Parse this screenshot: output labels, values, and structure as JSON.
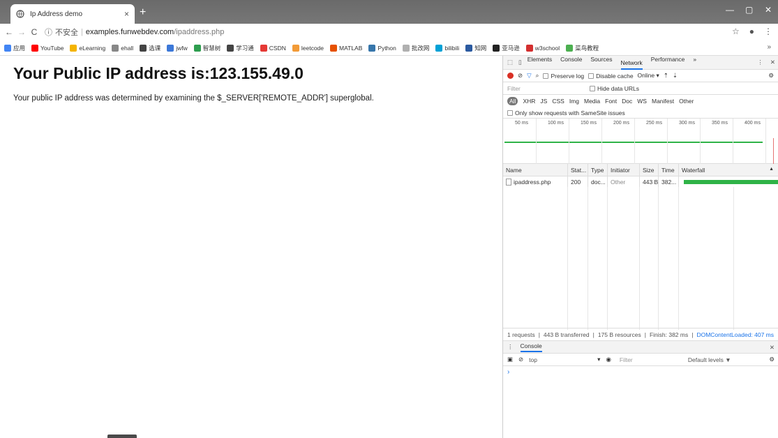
{
  "tab": {
    "title": "Ip Address demo",
    "close": "×",
    "new": "+"
  },
  "window": {
    "minimize": "—",
    "restore": "▢",
    "close": "✕"
  },
  "address": {
    "info_icon": "ⓘ",
    "insecure_label": "不安全",
    "separator": "|",
    "host": "examples.funwebdev.com",
    "path": "/ipaddress.php"
  },
  "bookmarks": [
    {
      "label": "应用",
      "color": "#4285f4"
    },
    {
      "label": "YouTube",
      "color": "#ff0000"
    },
    {
      "label": "eLearning",
      "color": "#f4b400"
    },
    {
      "label": "ehall",
      "color": "#888888"
    },
    {
      "label": "选课",
      "color": "#444444"
    },
    {
      "label": "jwfw",
      "color": "#3c78d8"
    },
    {
      "label": "智慧树",
      "color": "#2e9e4f"
    },
    {
      "label": "学习通",
      "color": "#444444"
    },
    {
      "label": "CSDN",
      "color": "#e53935"
    },
    {
      "label": "leetcode",
      "color": "#f29b38"
    },
    {
      "label": "MATLAB",
      "color": "#e65100"
    },
    {
      "label": "Python",
      "color": "#3776ab"
    },
    {
      "label": "批改网",
      "color": "#b0b0b0"
    },
    {
      "label": "bilibili",
      "color": "#00a1d6"
    },
    {
      "label": "知网",
      "color": "#2b5aa0"
    },
    {
      "label": "亚马逊",
      "color": "#222222"
    },
    {
      "label": "w3school",
      "color": "#d32f2f"
    },
    {
      "label": "菜鸟教程",
      "color": "#4caf50"
    }
  ],
  "bookmarks_more": "»",
  "page": {
    "heading": "Your Public IP address is:123.155.49.0",
    "text": "Your public IP address was determined by examining the $_SERVER['REMOTE_ADDR'] superglobal."
  },
  "devtools": {
    "tabs": [
      "Elements",
      "Console",
      "Sources",
      "Network",
      "Performance",
      "»"
    ],
    "active_tab": "Network",
    "toolbar": {
      "preserve_log": "Preserve log",
      "disable_cache": "Disable cache",
      "throttle": "Online"
    },
    "filter_placeholder": "Filter",
    "hide_data_urls": "Hide data URLs",
    "types": [
      "All",
      "XHR",
      "JS",
      "CSS",
      "Img",
      "Media",
      "Font",
      "Doc",
      "WS",
      "Manifest",
      "Other"
    ],
    "samesite": "Only show requests with SameSite issues",
    "ticks": [
      "50 ms",
      "100 ms",
      "150 ms",
      "200 ms",
      "250 ms",
      "300 ms",
      "350 ms",
      "400 ms"
    ],
    "columns": [
      "Name",
      "Stat...",
      "Type",
      "Initiator",
      "Size",
      "Time",
      "Waterfall"
    ],
    "rows": [
      {
        "name": "ipaddress.php",
        "status": "200",
        "type": "doc...",
        "initiator": "Other",
        "size": "443 B",
        "time": "382..."
      }
    ],
    "summary": {
      "requests": "1 requests",
      "transferred": "443 B transferred",
      "resources": "175 B resources",
      "finish": "Finish: 382 ms",
      "dcl": "DOMContentLoaded: 407 ms"
    },
    "console": {
      "tab": "Console",
      "context": "top",
      "filter_placeholder": "Filter",
      "levels": "Default levels ▼",
      "prompt": "›"
    }
  }
}
